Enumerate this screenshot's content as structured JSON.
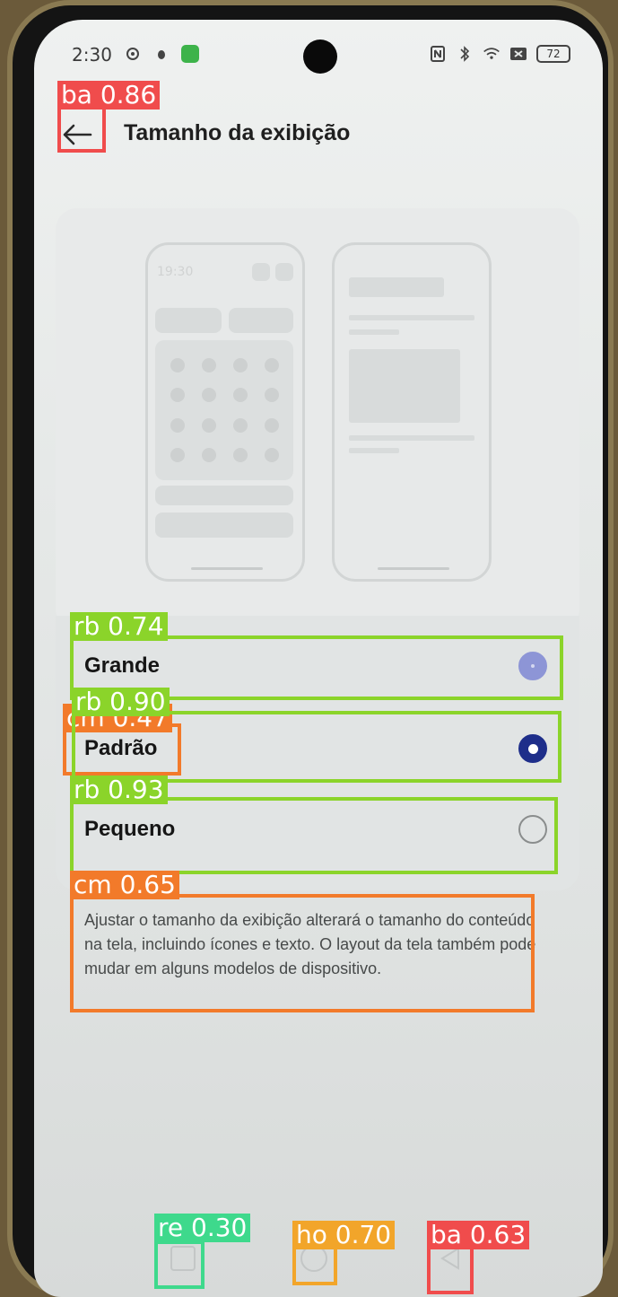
{
  "status_bar": {
    "time": "2:30",
    "battery": "72",
    "icons_left": [
      "gear-icon",
      "bug-icon",
      "app-icon"
    ],
    "icons_right": [
      "nfc-icon",
      "bluetooth-icon",
      "wifi-icon",
      "sim-icon",
      "battery-icon"
    ]
  },
  "header": {
    "title": "Tamanho da exibição",
    "back_icon": "arrow-left-icon"
  },
  "preview": {
    "mock_time": "19:30"
  },
  "options": [
    {
      "label": "Grande",
      "state": "dimmed"
    },
    {
      "label": "Padrão",
      "state": "selected"
    },
    {
      "label": "Pequeno",
      "state": "unselected"
    }
  ],
  "description": "Ajustar o tamanho da exibição alterará o tamanho do conteúdo na tela, incluindo ícones e texto. O layout da tela também pode mudar em alguns modelos de dispositivo.",
  "navbar": {
    "recent_icon": "square-icon",
    "home_icon": "circle-icon",
    "back_icon": "triangle-icon"
  },
  "colors": {
    "accent": "#1e2e8a",
    "detection_red": "#f04c4c",
    "detection_green": "#8bd42a",
    "detection_orange": "#f27a2a",
    "detection_teal": "#3ed98c",
    "detection_yellow": "#f2a52a"
  },
  "detections": [
    {
      "label": "ba 0.86",
      "color": "#f04c4c"
    },
    {
      "label": "rb 0.74",
      "color": "#8bd42a"
    },
    {
      "label": "cm 0.47",
      "color": "#f27a2a"
    },
    {
      "label": "rb 0.90",
      "color": "#8bd42a"
    },
    {
      "label": "rb 0.93",
      "color": "#8bd42a"
    },
    {
      "label": "cm 0.65",
      "color": "#f27a2a"
    },
    {
      "label": "re 0.30",
      "color": "#3ed98c"
    },
    {
      "label": "ho 0.70",
      "color": "#f2a52a"
    },
    {
      "label": "ba 0.63",
      "color": "#f04c4c"
    }
  ]
}
